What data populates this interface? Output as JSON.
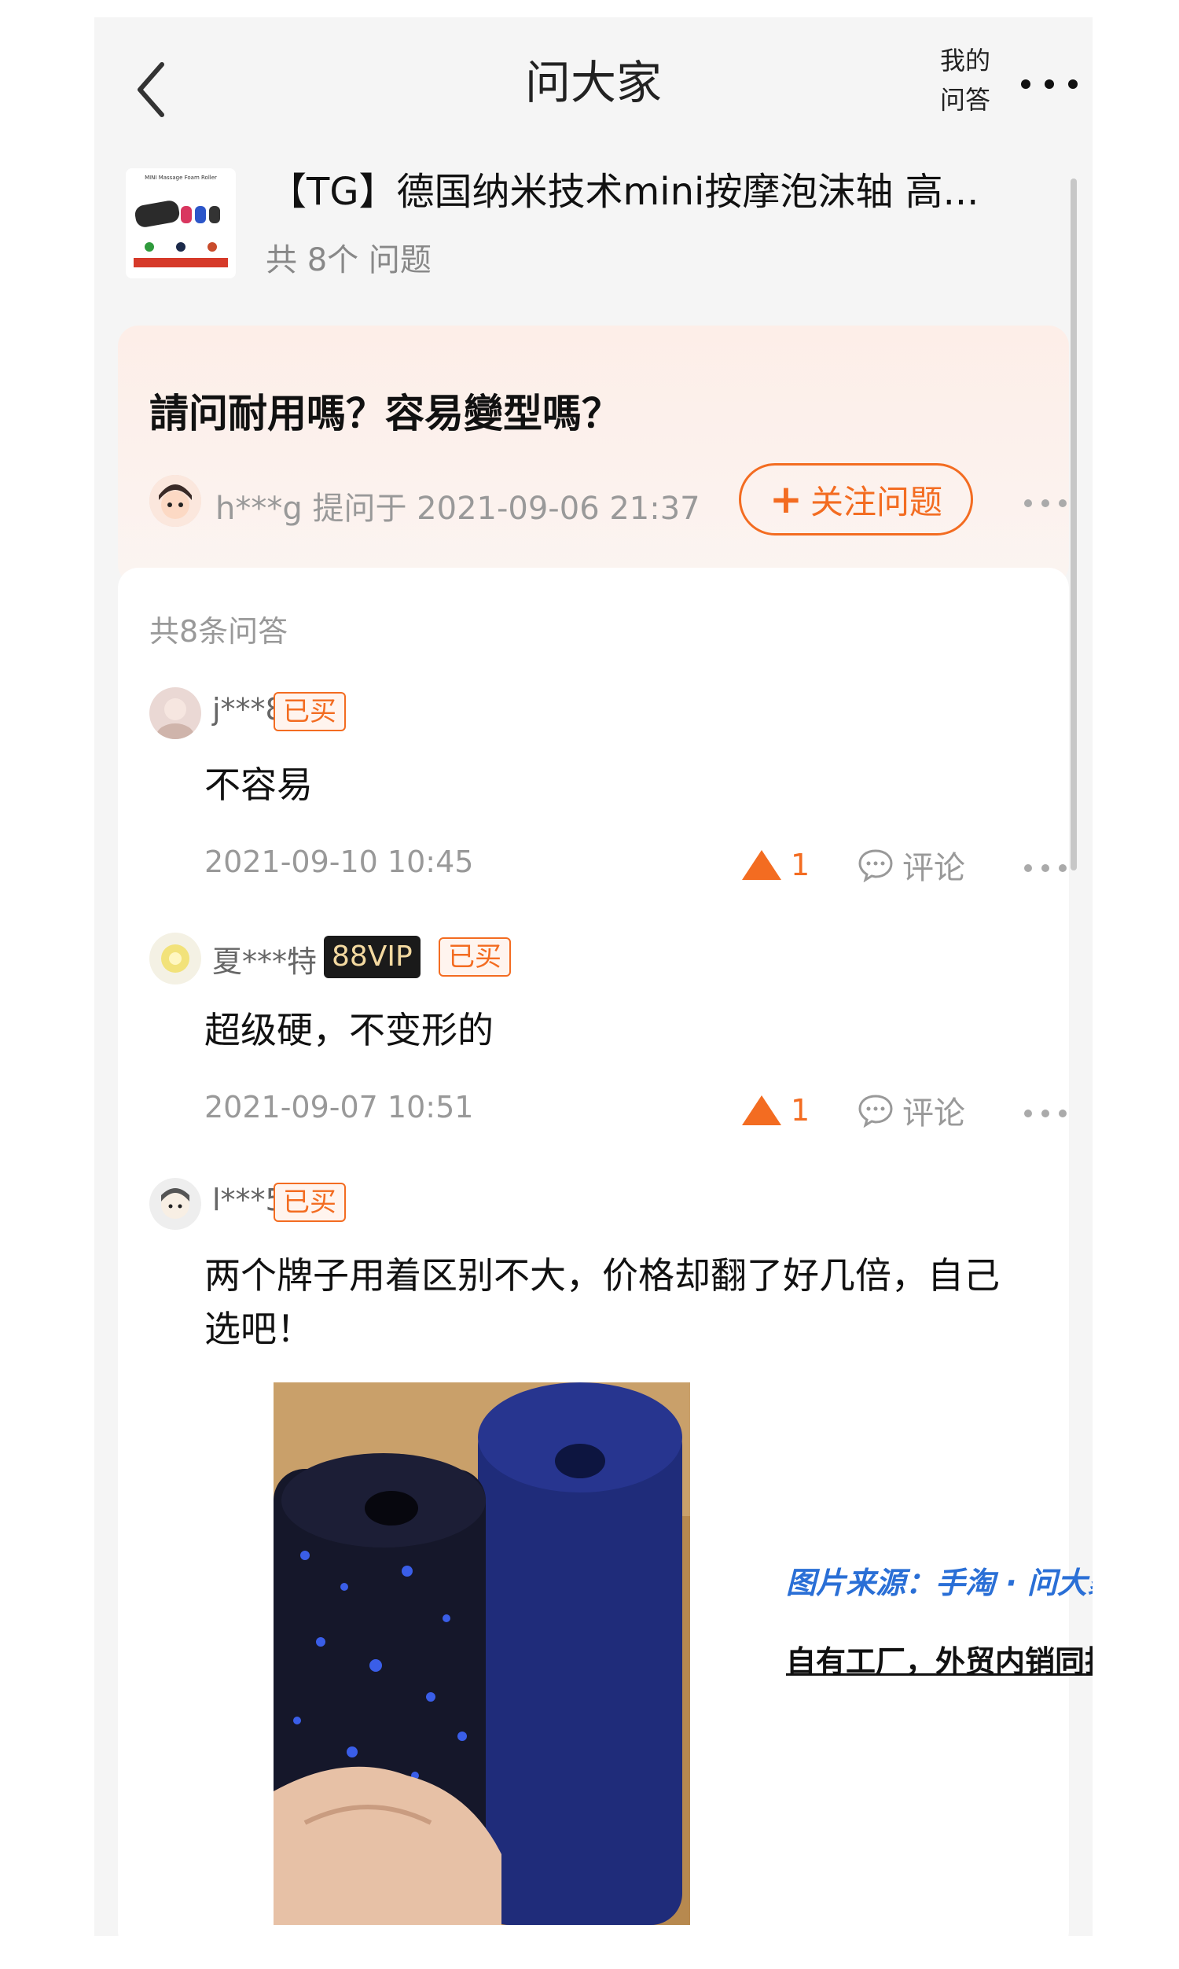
{
  "header": {
    "title": "问大家",
    "my_qa_line1": "我的",
    "my_qa_line2": "问答"
  },
  "product": {
    "title": "【TG】德国纳米技术mini按摩泡沫轴 高...",
    "question_count": "共 8个 问题",
    "thumb_caption": "MINI Massage Foam Roller"
  },
  "question": {
    "text": "請问耐用嗎？容易變型嗎？",
    "user": "h***g",
    "asked_at": "提问于 2021-09-06 21:37",
    "follow_label": "关注问题"
  },
  "answers_total": "共8条问答",
  "answers": [
    {
      "user": "j***8",
      "bought_badge": "已买",
      "text": "不容易",
      "date": "2021-09-10 10:45",
      "likes": "1",
      "comment_label": "评论"
    },
    {
      "user": "夏***特",
      "vip_badge": "88VIP",
      "bought_badge": "已买",
      "text": "超级硬，不变形的",
      "date": "2021-09-07 10:51",
      "likes": "1",
      "comment_label": "评论"
    },
    {
      "user": "l***5",
      "bought_badge": "已买",
      "text": "两个牌子用着区别不大，价格却翻了好几倍，自己选吧！"
    }
  ],
  "overlay": {
    "source": "图片来源：手淘 · 问大家",
    "factory": "自有工厂，外贸内销同批次"
  },
  "colors": {
    "accent": "#f36c21",
    "vip_bg": "#1a1a1a",
    "vip_text": "#f3d9a0",
    "source_blue": "#2a6fd6"
  }
}
